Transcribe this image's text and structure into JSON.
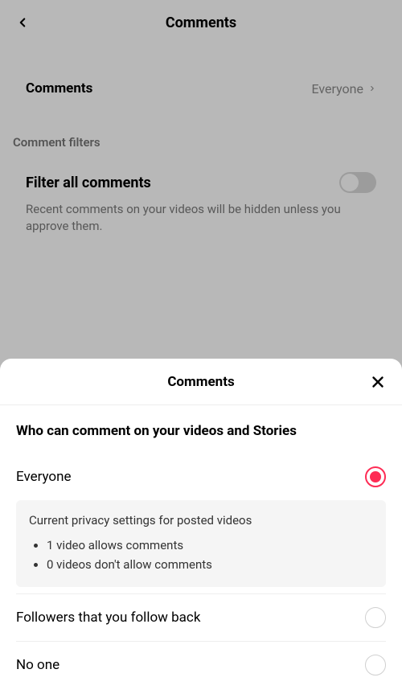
{
  "header": {
    "title": "Comments"
  },
  "setting": {
    "label": "Comments",
    "value": "Everyone"
  },
  "section_label": "Comment filters",
  "filter": {
    "title": "Filter all comments",
    "desc": "Recent comments on your videos will be hidden unless you approve them.",
    "toggle_on": false
  },
  "sheet": {
    "title": "Comments",
    "subhead": "Who can comment on your videos and Stories",
    "options": [
      {
        "label": "Everyone",
        "selected": true
      },
      {
        "label": "Followers that you follow back",
        "selected": false
      },
      {
        "label": "No one",
        "selected": false
      }
    ],
    "info": {
      "title": "Current privacy settings for posted videos",
      "items": [
        "1 video allows comments",
        "0 videos don't allow comments"
      ]
    }
  },
  "colors": {
    "accent": "#fe2c55"
  }
}
